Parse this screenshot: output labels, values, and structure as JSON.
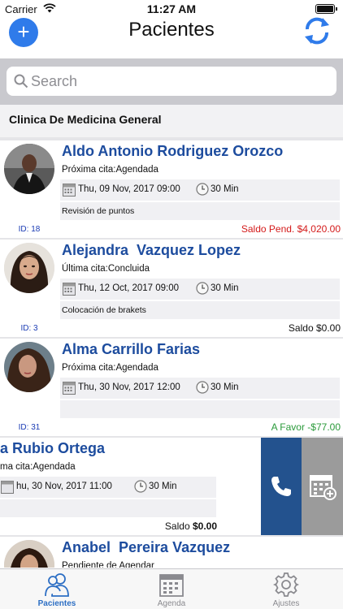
{
  "status_bar": {
    "carrier": "Carrier",
    "time": "11:27 AM"
  },
  "nav": {
    "title": "Pacientes",
    "add_icon": "plus-icon",
    "refresh_icon": "refresh-icon"
  },
  "search": {
    "placeholder": "Search",
    "value": ""
  },
  "section": {
    "title": "Clinica De Medicina General"
  },
  "patients": [
    {
      "name": "Aldo Antonio Rodriguez Orozco",
      "id": "ID: 18",
      "status_label": "Próxima cita:",
      "status_value": "Agendada",
      "date": "Thu, 09 Nov, 2017 09:00",
      "duration": "30 Min",
      "note": "Revisión de puntos",
      "balance_label": "Saldo Pend.",
      "balance_amount": "$4,020.00",
      "balance_color": "#d41a1a"
    },
    {
      "name": "Alejandra  Vazquez Lopez",
      "id": "ID: 3",
      "status_label": "Última cita:",
      "status_value": "Concluida",
      "date": "Thu, 12 Oct, 2017 09:00",
      "duration": "30 Min",
      "note": "Colocación de brakets",
      "balance_label": "Saldo",
      "balance_amount": "$0.00",
      "balance_color": "#111111"
    },
    {
      "name": "Alma Carrillo Farias",
      "id": "ID: 31",
      "status_label": "Próxima cita:",
      "status_value": "Agendada",
      "date": "Thu, 30 Nov, 2017 12:00",
      "duration": "30 Min",
      "note": "",
      "balance_label": "A Favor",
      "balance_amount": "-$77.00",
      "balance_color": "#2a9a3a"
    },
    {
      "name": "a Rubio Ortega",
      "id": "",
      "status_label": "ma cita:",
      "status_value": "Agendada",
      "date": "hu, 30 Nov, 2017 11:00",
      "duration": "30 Min",
      "note": "",
      "balance_label": "Saldo",
      "balance_amount": "$0.00",
      "balance_color": "#111111",
      "actions": {
        "call_icon": "phone-icon",
        "schedule_icon": "calendar-add-icon"
      }
    },
    {
      "name": "Anabel  Pereira Vazquez",
      "id": "",
      "status_label": "Pendiente de Agendar",
      "status_value": "",
      "date": "",
      "duration": "",
      "note": "",
      "balance_label": "",
      "balance_amount": "",
      "balance_color": "#111111"
    }
  ],
  "tabs": [
    {
      "label": "Pacientes",
      "icon": "patients-icon",
      "active": true
    },
    {
      "label": "Agenda",
      "icon": "calendar-icon",
      "active": false
    },
    {
      "label": "Ajustes",
      "icon": "gear-icon",
      "active": false
    }
  ],
  "colors": {
    "accent": "#2f7bea",
    "name": "#1d4c9e",
    "call_action": "#23528e",
    "schedule_action": "#9b9b9b"
  }
}
